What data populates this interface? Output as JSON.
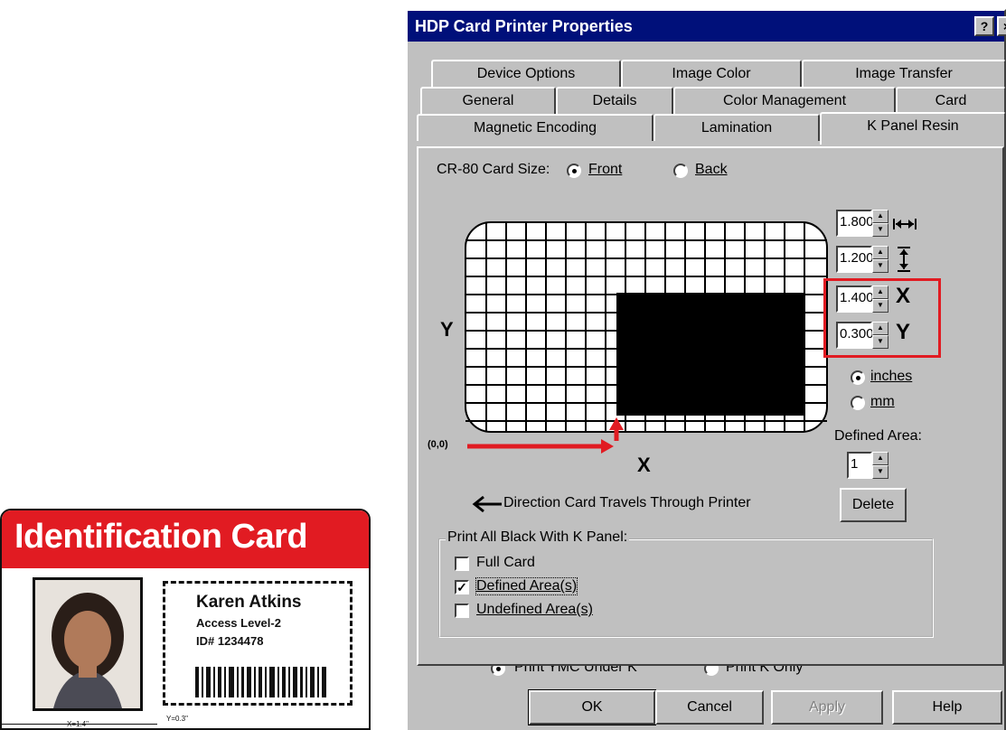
{
  "id_card": {
    "header": "Identification Card",
    "name": "Karen Atkins",
    "access": "Access Level-2",
    "id_number": "ID# 1234478",
    "dim_x": "X=1.4\"",
    "dim_y": "Y=0.3\""
  },
  "dialog": {
    "title": "HDP Card Printer Properties",
    "help_button": "?",
    "close_button": "×",
    "tabs_row1": [
      "Device Options",
      "Image Color",
      "Image Transfer"
    ],
    "tabs_row2": [
      "General",
      "Details",
      "Color Management",
      "Card"
    ],
    "tabs_row3": [
      "Magnetic Encoding",
      "Lamination",
      "K Panel Resin"
    ],
    "active_tab": "K Panel Resin",
    "card_size_label": "CR-80 Card Size:",
    "side_front": "Front",
    "side_back": "Back",
    "selected_side": "Front",
    "width_value": "1.800",
    "height_value": "1.200",
    "x_value": "1.400",
    "y_value": "0.300",
    "x_label": "X",
    "y_label": "Y",
    "axis_y": "Y",
    "axis_x": "X",
    "origin_label": "(0,0)",
    "unit_inches": "inches",
    "unit_mm": "mm",
    "selected_unit": "inches",
    "defined_area_label": "Defined Area:",
    "defined_area_value": "1",
    "delete_button": "Delete",
    "direction_text": "Direction Card Travels Through Printer",
    "group_label": "Print All Black With K Panel:",
    "opt_full_card": "Full Card",
    "opt_defined": "Defined Area(s)",
    "opt_undefined": "Undefined Area(s)",
    "checked_option": "Defined Area(s)",
    "print_ymc": "Print YMC Under K",
    "print_k_only": "Print K Only",
    "selected_print": "Print YMC Under K",
    "ok_button": "OK",
    "cancel_button": "Cancel",
    "apply_button": "Apply",
    "help_label": "Help"
  },
  "colors": {
    "title_bar": "#00107a",
    "card_red": "#e11b22",
    "dialog_face": "#c0c0c0"
  }
}
